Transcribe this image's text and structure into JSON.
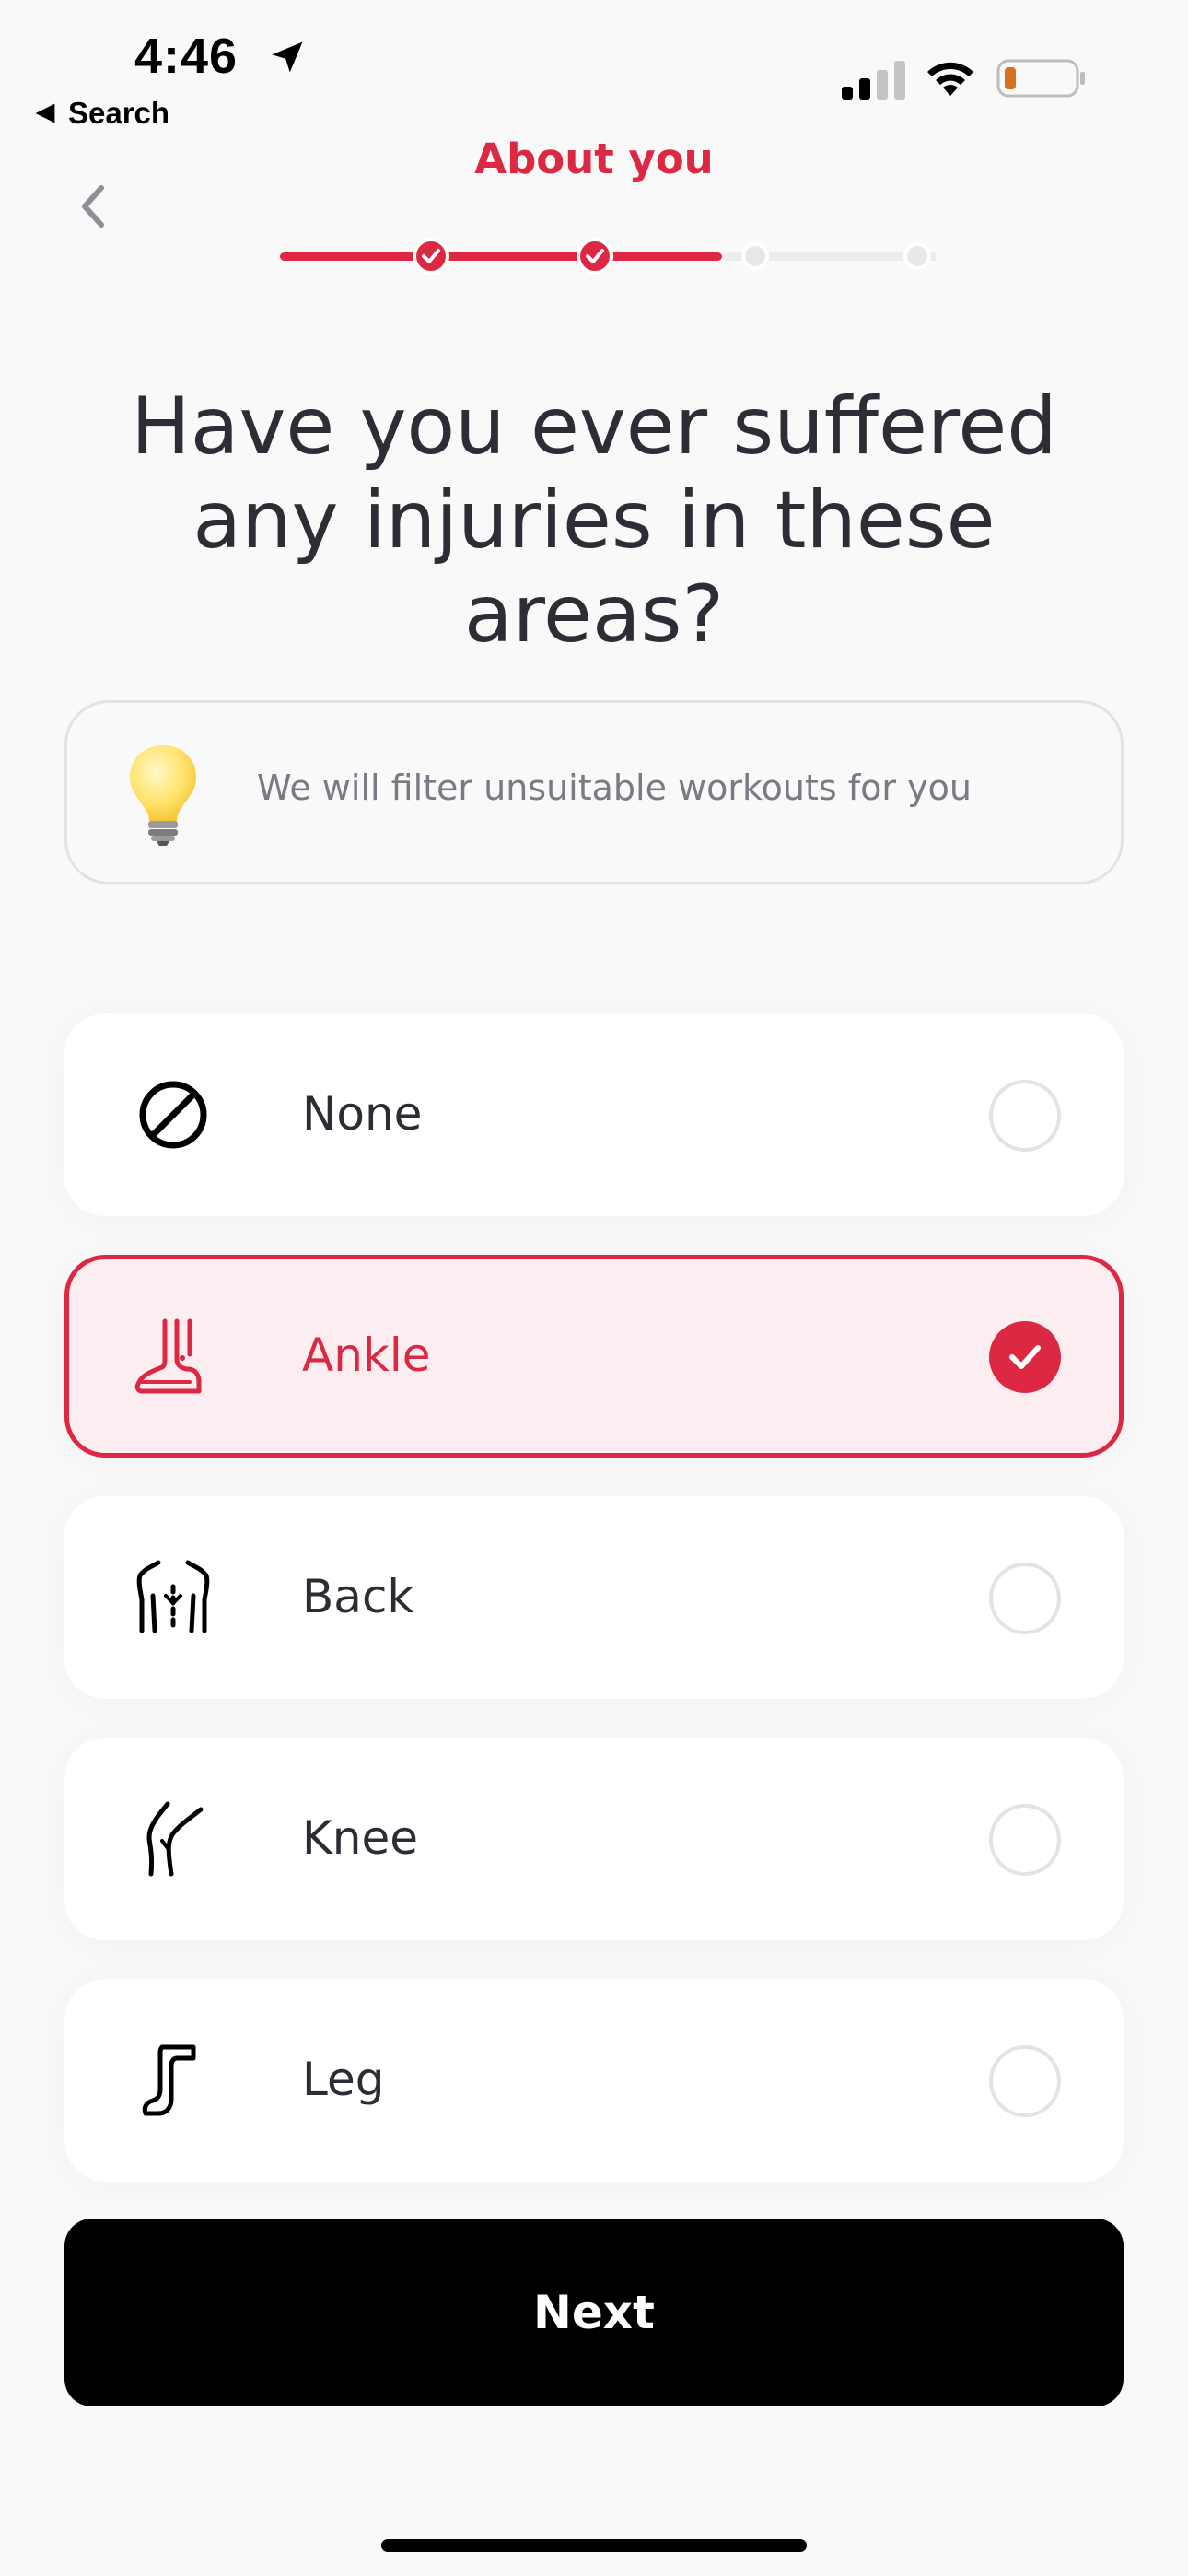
{
  "status_bar": {
    "time": "4:46",
    "back_app": "Search"
  },
  "header": {
    "title": "About you",
    "progress": {
      "total_steps": 4,
      "completed_steps": 2,
      "current_step": 3,
      "current_step_fill": 0.0
    }
  },
  "question": "Have you ever suffered any injuries in these areas?",
  "tip": {
    "icon": "light-bulb-icon",
    "text": "We will filter unsuitable workouts for you"
  },
  "options": [
    {
      "label": "None",
      "icon": "prohibited-icon",
      "selected": false
    },
    {
      "label": "Ankle",
      "icon": "ankle-icon",
      "selected": true
    },
    {
      "label": "Back",
      "icon": "back-icon",
      "selected": false
    },
    {
      "label": "Knee",
      "icon": "knee-icon",
      "selected": false
    },
    {
      "label": "Leg",
      "icon": "leg-icon",
      "selected": false
    }
  ],
  "next_button": {
    "label": "Next"
  },
  "colors": {
    "accent": "#dc2843",
    "selected_bg": "#fceef0",
    "background": "#f9f9f9",
    "button": "#000000"
  }
}
